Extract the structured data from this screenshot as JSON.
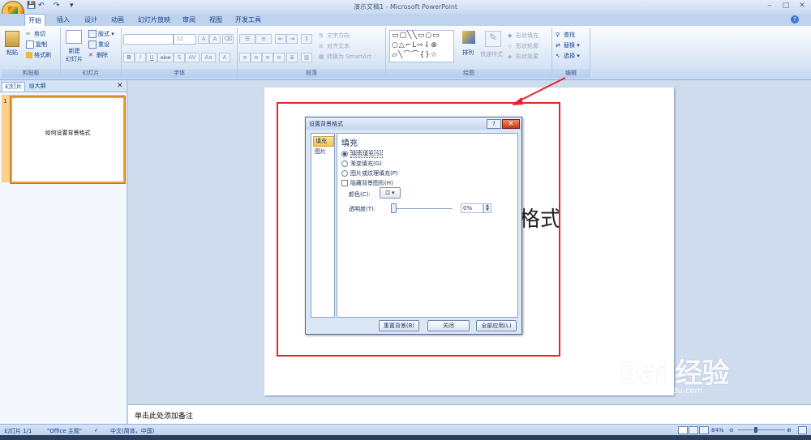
{
  "window": {
    "title": "演示文稿1 - Microsoft PowerPoint",
    "minimize": "‒",
    "maximize": "□",
    "close": "✕"
  },
  "qat": {
    "save": "💾",
    "undo": "↶",
    "redo": "↷",
    "customize": "▾"
  },
  "tabs": [
    "开始",
    "插入",
    "设计",
    "动画",
    "幻灯片放映",
    "审阅",
    "视图",
    "开发工具"
  ],
  "ribbon": {
    "clipboard": {
      "label": "剪贴板",
      "paste": "粘贴",
      "cut": "剪切",
      "copy": "复制",
      "format_painter": "格式刷"
    },
    "slides": {
      "label": "幻灯片",
      "new_slide": "新建\n幻灯片",
      "layout": "版式",
      "reset": "重设",
      "delete": "删除"
    },
    "font": {
      "label": "字体",
      "size": "32"
    },
    "paragraph": {
      "label": "段落",
      "text_direction": "文字方向",
      "align_text": "对齐文本",
      "smartart": "转换为 SmartArt"
    },
    "drawing": {
      "label": "绘图",
      "arrange": "排列",
      "quick_styles": "快速样式",
      "shape_fill": "形状填充",
      "shape_outline": "形状轮廓",
      "shape_effects": "形状效果"
    },
    "editing": {
      "label": "编辑",
      "find": "查找",
      "replace": "替换",
      "select": "选择"
    }
  },
  "left_pane": {
    "tab_slides": "幻灯片",
    "tab_outline": "大纲",
    "slide_number": "1",
    "thumb_title": "如何设置背景格式"
  },
  "slide": {
    "visible_text": "格式"
  },
  "dialog": {
    "title": "设置背景格式",
    "help": "?",
    "close": "✕",
    "nav": [
      "填充",
      "图片"
    ],
    "section_title": "填充",
    "options": [
      "纯色填充(S)",
      "渐变填充(G)",
      "图片或纹理填充(P)"
    ],
    "hide_graphics": "隐藏背景图形(H)",
    "color_label": "颜色(C):",
    "transparency_label": "透明度(T):",
    "transparency_value": "0%",
    "buttons": {
      "reset": "重置背景(B)",
      "close": "关闭",
      "apply_all": "全部应用(L)"
    }
  },
  "notes": {
    "placeholder": "单击此处添加备注"
  },
  "status": {
    "slide": "幻灯片 1/1",
    "theme": "\"Office 主题\"",
    "language": "中文(简体，中国)",
    "zoom": "84%"
  },
  "watermark": {
    "brand": "Bai 经验",
    "url": "jingyan.baidu.com"
  },
  "colors": {
    "annotation_red": "#e3262a",
    "selection_orange": "#f0a030"
  }
}
